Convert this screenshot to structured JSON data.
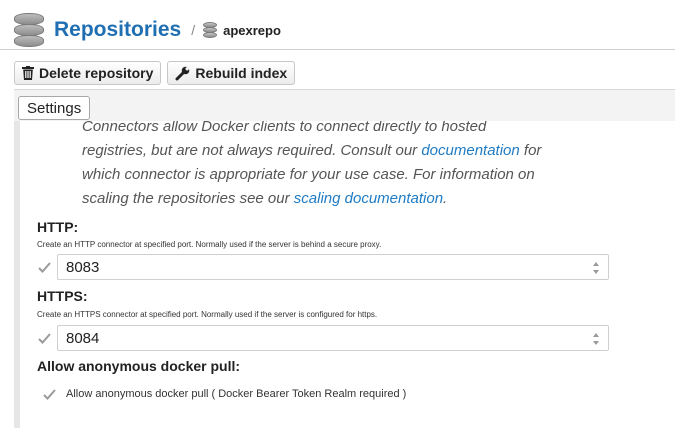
{
  "header": {
    "title": "Repositories",
    "separator": "/",
    "repo_name": "apexrepo"
  },
  "toolbar": {
    "delete_label": "Delete repository",
    "rebuild_label": "Rebuild index"
  },
  "tabs": {
    "settings_label": "Settings"
  },
  "info": {
    "line1": "Connectors allow Docker clients to connect directly to hosted",
    "line2_pre": "registries, but are not always required. Consult our ",
    "doc_link": "documentation",
    "line2_post": " for",
    "line3": "which connector is appropriate for your use case. For information on",
    "line4_pre": "scaling the repositories see our ",
    "scaling_link": "scaling documentation",
    "line4_post": "."
  },
  "http": {
    "title": "HTTP:",
    "description": "Create an HTTP connector at specified port. Normally used if the server is behind a secure proxy.",
    "enabled": true,
    "port": "8083"
  },
  "https": {
    "title": "HTTPS:",
    "description": "Create an HTTPS connector at specified port. Normally used if the server is configured for https.",
    "enabled": true,
    "port": "8084"
  },
  "anonymous": {
    "title": "Allow anonymous docker pull:",
    "checkbox_label": "Allow anonymous docker pull ( Docker Bearer Token Realm required )",
    "checked": true
  },
  "colors": {
    "accent": "#1f6fb2",
    "link": "#1f7bc4"
  },
  "icons": {
    "repositories": "database-icon",
    "repo": "database-icon",
    "delete": "trash-icon",
    "rebuild": "wrench-icon",
    "checkbox": "checkmark-icon",
    "spinner": "spinner-arrows-icon"
  }
}
